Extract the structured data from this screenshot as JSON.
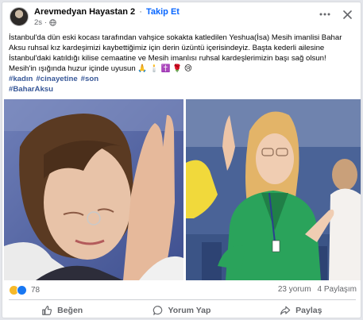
{
  "post": {
    "author": "Arevmedyan Hayastan 2",
    "separator": "·",
    "follow_label": "Takip Et",
    "timestamp": "2s",
    "lines": [
      "İstanbul'da dün eski kocası tarafından vahşice sokakta katledilen Yeshua(İsa) Mesih imanlisi Bahar",
      "Aksu ruhsal kız kardeşimizi kaybettiğimiz için derin üzüntü içerisindeyiz. Başta kederli ailesine",
      "İstanbul'daki katıldığı kilise cemaatine ve Mesih imanlısı ruhsal kardeşlerimizin başı sağ olsun!",
      "Mesih'in ışığında huzur içinde uyusun"
    ],
    "emojis": "🙏 🕯️ ✝️ 🌹 😢",
    "hashtags_line1": [
      "#kadın",
      "#cinayetine",
      "#son"
    ],
    "hashtag_line2": "#BaharAksu"
  },
  "stats": {
    "reaction_count": "78",
    "comments": "23 yorum",
    "shares": "4 Paylaşım"
  },
  "actions": {
    "like": "Beğen",
    "comment": "Yorum Yap",
    "share": "Paylaş"
  },
  "colors": {
    "link": "#385898",
    "follow": "#0866ff",
    "muted": "#65676b",
    "like_blue": "#1877f2",
    "sad_yellow": "#f7b928"
  },
  "icons": {
    "privacy": "globe-icon",
    "more": "more-horizontal-icon",
    "close": "close-icon",
    "like": "thumbs-up-icon",
    "comment": "comment-bubble-icon",
    "share": "share-arrow-icon"
  }
}
